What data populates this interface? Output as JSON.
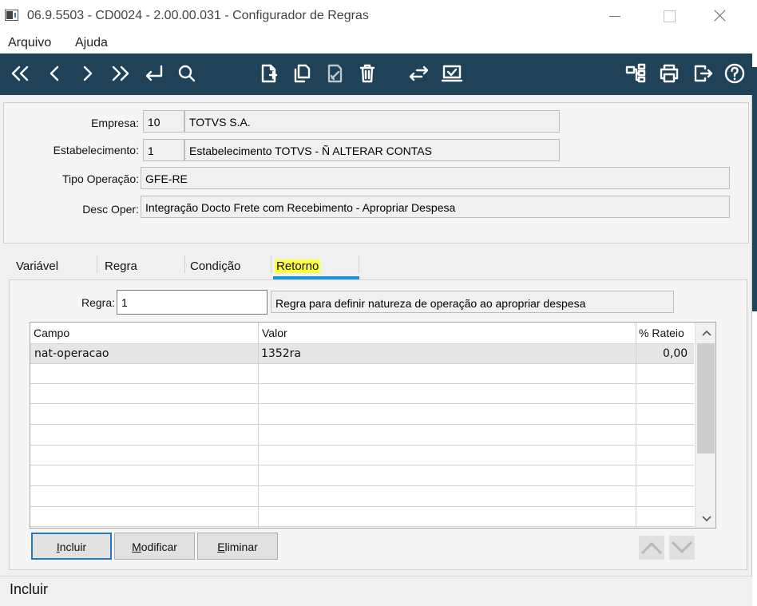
{
  "window": {
    "title": "06.9.5503 - CD0024 - 2.00.00.031 - Configurador de Regras"
  },
  "menu": {
    "items": [
      {
        "label": "Arquivo"
      },
      {
        "label": "Ajuda"
      }
    ]
  },
  "toolbar": {
    "icons": [
      "first-record-icon",
      "previous-record-icon",
      "next-record-icon",
      "last-record-icon",
      "go-to-icon",
      "search-icon",
      "new-document-icon",
      "copy-document-icon",
      "edit-document-icon",
      "delete-icon",
      "switch-icon",
      "monitor-check-icon",
      "sitemap-icon",
      "print-icon",
      "exit-icon",
      "help-icon"
    ]
  },
  "header": {
    "empresa": {
      "label": "Empresa:",
      "code": "10",
      "name": "TOTVS S.A."
    },
    "estabelecimento": {
      "label": "Estabelecimento:",
      "code": "1",
      "name": "Estabelecimento TOTVS - Ñ ALTERAR CONTAS"
    },
    "tipo_operacao": {
      "label": "Tipo Operação:",
      "value": "GFE-RE"
    },
    "desc_oper": {
      "label": "Desc Oper:",
      "value": "Integração Docto Frete com Recebimento - Apropriar Despesa"
    }
  },
  "tabs": [
    {
      "label": "Variável"
    },
    {
      "label": "Regra"
    },
    {
      "label": "Condição"
    },
    {
      "label": "Retorno",
      "active": true
    }
  ],
  "retorno": {
    "regra_label": "Regra:",
    "regra_code": "1",
    "regra_desc": "Regra para definir natureza de operação ao apropriar despesa",
    "grid": {
      "columns": [
        "Campo",
        "Valor",
        "% Rateio"
      ],
      "rows": [
        {
          "campo": "nat-operacao",
          "valor": "1352ra",
          "rateio": "0,00"
        }
      ]
    },
    "buttons": {
      "incluir": {
        "mnemonic": "I",
        "rest": "ncluir"
      },
      "modificar": {
        "mnemonic": "M",
        "rest": "odificar"
      },
      "eliminar": {
        "mnemonic": "E",
        "rest": "liminar"
      }
    }
  },
  "status": {
    "text": "Incluir"
  },
  "colors": {
    "toolbar_bg": "#1f4258",
    "tab_highlight": "#ffff3c",
    "tab_underline": "#1a96d6",
    "primary_border": "#2777c9"
  }
}
